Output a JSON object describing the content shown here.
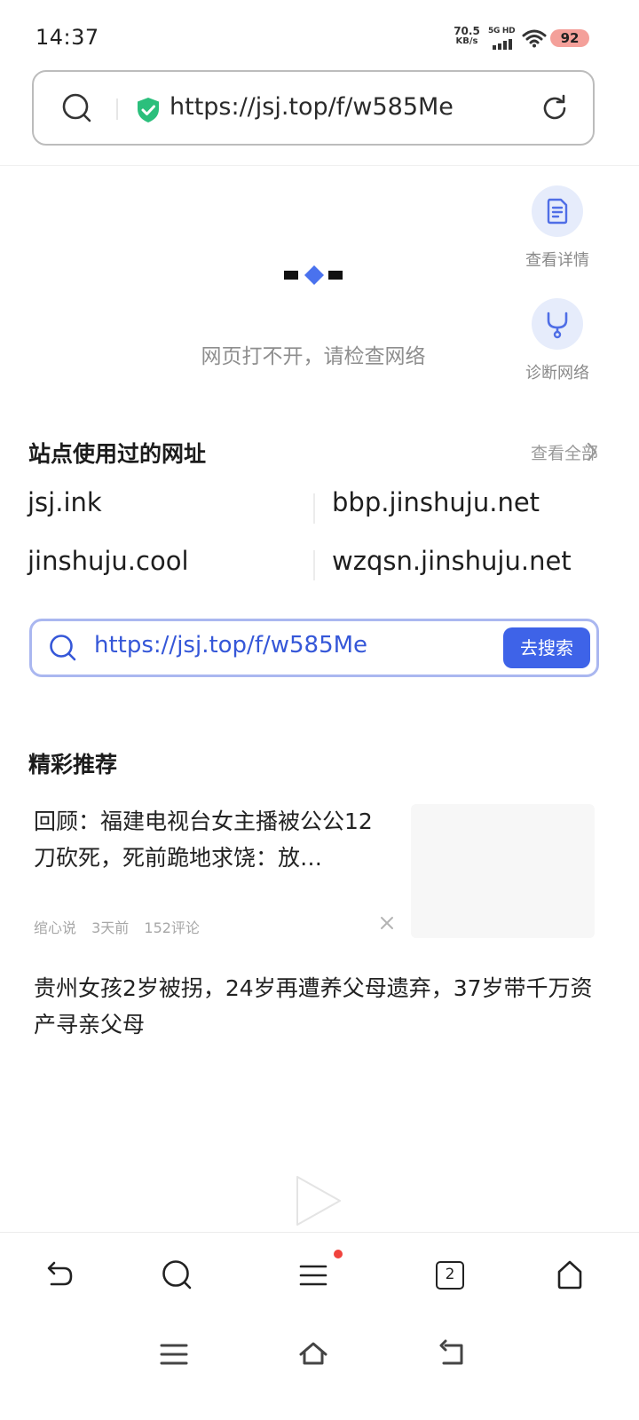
{
  "status_bar": {
    "time": "14:37",
    "net_speed_value": "70.5",
    "net_speed_unit": "KB/s",
    "signal_label": "5G HD",
    "battery": "92",
    "battery_color": "#f4a09a"
  },
  "url_bar": {
    "url": "https://jsj.top/f/w585Me",
    "secure_color": "#2bbf7c"
  },
  "side_actions": {
    "details_label": "查看详情",
    "diagnose_label": "诊断网络"
  },
  "error": {
    "message": "网页打不开，请检查网络"
  },
  "sites": {
    "title": "站点使用过的网址",
    "view_all": "查看全部",
    "links": [
      "jsj.ink",
      "bbp.jinshuju.net",
      "jinshuju.cool",
      "wzqsn.jinshuju.net"
    ]
  },
  "search": {
    "query": "https://jsj.top/f/w585Me",
    "button": "去搜索",
    "accent": "#3e63e8"
  },
  "recommend": {
    "title": "精彩推荐",
    "articles": [
      {
        "title": "回顾：福建电视台女主播被公公12刀砍死，死前跪地求饶：放…",
        "source": "绾心说",
        "time": "3天前",
        "comments": "152评论"
      },
      {
        "title": "贵州女孩2岁被拐，24岁再遭养父母遗弃，37岁带千万资产寻亲父母"
      }
    ]
  },
  "bottom_bar": {
    "tab_count": "2",
    "icons": [
      "back-icon",
      "search-icon",
      "menu-icon",
      "tabs-icon",
      "home-icon"
    ]
  },
  "system_nav": {
    "icons": [
      "recents-icon",
      "home-icon",
      "back-icon"
    ]
  }
}
